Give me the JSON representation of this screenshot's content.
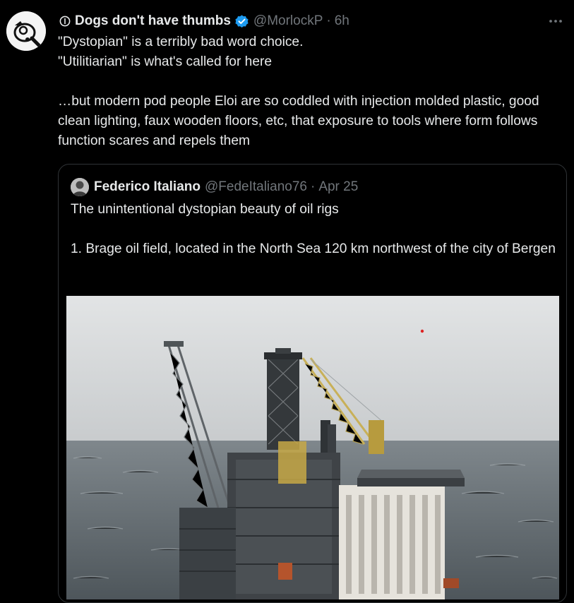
{
  "tweet": {
    "author_name": "Dogs don't have thumbs",
    "handle": "@MorlockP",
    "separator": "·",
    "time": "6h",
    "verified_icon": "verified-badge-icon",
    "more_icon": "more-dots-icon",
    "lines": [
      "\"Dystopian\" is a terribly bad word choice.",
      "\"Utilitiarian\" is what's called for here",
      "…but modern pod people Eloi are so coddled with injection molded plastic, good clean lighting, faux wooden floors, etc, that exposure to tools where form follows function scares and repels them"
    ]
  },
  "quote": {
    "author_name": "Federico Italiano",
    "handle": "@FedeItaliano76",
    "separator": "·",
    "date": "Apr 25",
    "lines": [
      "The unintentional dystopian beauty of oil rigs",
      "1. Brage oil field,  located in the North Sea 120 km northwest of the city of Bergen"
    ],
    "media_icon": "oil-rig-photo"
  },
  "colors": {
    "background": "#000000",
    "text": "#e7e9ea",
    "muted": "#71767b",
    "border": "#2f3336",
    "verified": "#1d9bf0"
  }
}
